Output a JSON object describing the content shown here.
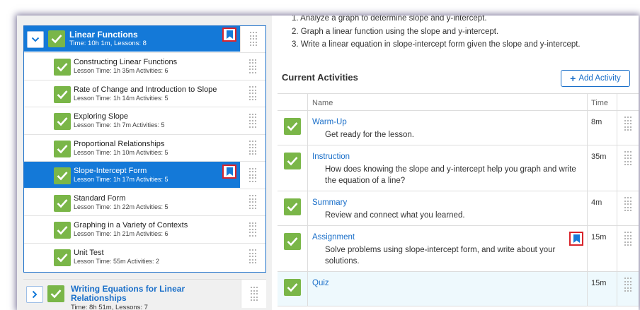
{
  "unit": {
    "title": "Linear Functions",
    "meta": "Time: 10h 1m, Lessons: 8"
  },
  "lessons": [
    {
      "title": "Constructing Linear Functions",
      "meta": "Lesson Time: 1h 35m   Activities: 6"
    },
    {
      "title": "Rate of Change and Introduction to Slope",
      "meta": "Lesson Time: 1h 14m   Activities: 5"
    },
    {
      "title": "Exploring Slope",
      "meta": "Lesson Time: 1h 7m   Activities: 5"
    },
    {
      "title": "Proportional Relationships",
      "meta": "Lesson Time: 1h 10m   Activities: 5"
    },
    {
      "title": "Slope-Intercept Form",
      "meta": "Lesson Time: 1h 17m   Activities: 5",
      "active": true
    },
    {
      "title": "Standard Form",
      "meta": "Lesson Time: 1h 22m   Activities: 5"
    },
    {
      "title": "Graphing in a Variety of Contexts",
      "meta": "Lesson Time: 1h 21m   Activities: 6"
    },
    {
      "title": "Unit Test",
      "meta": "Lesson Time: 55m   Activities: 2"
    }
  ],
  "next_unit": {
    "title": "Writing Equations for Linear Relationships",
    "meta": "Time: 8h 51m, Lessons: 7"
  },
  "objectives": [
    "1. Analyze a graph to determine slope and y-intercept.",
    "2. Graph a linear function using the slope and y-intercept.",
    "3. Write a linear equation in slope-intercept form given the slope and y-intercept."
  ],
  "current_activities": {
    "title": "Current Activities",
    "add_button": "Add Activity",
    "columns": {
      "name": "Name",
      "time": "Time"
    },
    "rows": [
      {
        "name": "Warm-Up",
        "desc": "Get ready for the lesson.",
        "time": "8m"
      },
      {
        "name": "Instruction",
        "desc": "How does knowing the slope and y-intercept help you graph and write the equation of a line?",
        "time": "35m"
      },
      {
        "name": "Summary",
        "desc": "Review and connect what you learned.",
        "time": "4m"
      },
      {
        "name": "Assignment",
        "desc": "Solve problems using slope-intercept form, and write about your solutions.",
        "time": "15m",
        "bookmarked": true
      },
      {
        "name": "Quiz",
        "desc": "",
        "time": "15m"
      }
    ]
  },
  "colors": {
    "accent": "#1479d8",
    "check_green": "#7ab648",
    "bookmark_highlight": "#d9242b",
    "link": "#1a6fc9"
  }
}
